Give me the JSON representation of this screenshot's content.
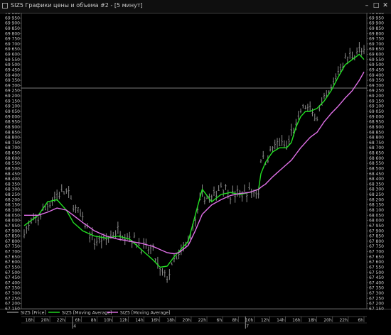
{
  "window": {
    "title": "SIZ5 Графики цены и объема #2 - [5 минут]",
    "buttons": {
      "minimize": "–",
      "maximize": "□",
      "close": "✕"
    }
  },
  "colors": {
    "background": "#000000",
    "price": "#8a8a8a",
    "ma_fast": "#22e022",
    "ma_slow": "#e070e8",
    "axis_text": "#c8c8c8",
    "gridline": "#3a3a3a"
  },
  "chart_data": {
    "type": "line",
    "title": "",
    "ylim": [
      67150,
      70000
    ],
    "y_tick_step": 50,
    "horizontal_level": 69275,
    "x_tick_labels": [
      "18h",
      "20h",
      "22h",
      "6h",
      "8h",
      "10h",
      "12h",
      "14h",
      "16h",
      "18h",
      "20h",
      "22h",
      "6h",
      "8h",
      "10h",
      "12h",
      "14h",
      "16h",
      "18h",
      "20h",
      "22h",
      "6h"
    ],
    "day_markers": [
      {
        "label": "4",
        "after_tick": 2
      },
      {
        "label": "7",
        "after_tick": 13
      }
    ],
    "legend_placement": "bottom",
    "series": [
      {
        "name": "SIZ5 [Price]",
        "style": "bars",
        "color": "#8a8a8a",
        "anchors": [
          [
            0,
            67900
          ],
          [
            6,
            68020
          ],
          [
            10,
            68150
          ],
          [
            14,
            68250
          ],
          [
            18,
            68280
          ],
          [
            21,
            68150
          ],
          [
            25,
            68000
          ],
          [
            30,
            67800
          ],
          [
            35,
            67820
          ],
          [
            40,
            67900
          ],
          [
            45,
            67850
          ],
          [
            50,
            67750
          ],
          [
            55,
            67700
          ],
          [
            58,
            67500
          ],
          [
            61,
            67450
          ],
          [
            64,
            67600
          ],
          [
            66,
            67650
          ],
          [
            70,
            67800
          ],
          [
            73,
            68000
          ],
          [
            76,
            68250
          ],
          [
            80,
            68200
          ],
          [
            84,
            68350
          ],
          [
            88,
            68250
          ],
          [
            92,
            68250
          ],
          [
            96,
            68280
          ],
          [
            100,
            68270
          ],
          [
            101,
            68600
          ],
          [
            103,
            68580
          ],
          [
            106,
            68700
          ],
          [
            109,
            68750
          ],
          [
            112,
            68700
          ],
          [
            114,
            68850
          ],
          [
            116,
            68900
          ],
          [
            118,
            69050
          ],
          [
            120,
            69100
          ],
          [
            122,
            69050
          ],
          [
            125,
            69000
          ],
          [
            128,
            69150
          ],
          [
            131,
            69250
          ],
          [
            134,
            69450
          ],
          [
            137,
            69550
          ],
          [
            140,
            69600
          ],
          [
            143,
            69650
          ],
          [
            145,
            69600
          ]
        ],
        "noise": 90
      },
      {
        "name": "SIZ5 [Moving Average]",
        "style": "line",
        "color": "#22e022",
        "anchors": [
          [
            0,
            67950
          ],
          [
            6,
            68050
          ],
          [
            10,
            68180
          ],
          [
            14,
            68200
          ],
          [
            18,
            68100
          ],
          [
            21,
            67980
          ],
          [
            25,
            67900
          ],
          [
            30,
            67850
          ],
          [
            35,
            67830
          ],
          [
            40,
            67850
          ],
          [
            45,
            67820
          ],
          [
            50,
            67720
          ],
          [
            55,
            67620
          ],
          [
            58,
            67550
          ],
          [
            61,
            67560
          ],
          [
            64,
            67650
          ],
          [
            66,
            67700
          ],
          [
            70,
            67800
          ],
          [
            73,
            68050
          ],
          [
            76,
            68300
          ],
          [
            80,
            68180
          ],
          [
            84,
            68250
          ],
          [
            88,
            68270
          ],
          [
            92,
            68250
          ],
          [
            96,
            68270
          ],
          [
            100,
            68300
          ],
          [
            101,
            68450
          ],
          [
            103,
            68560
          ],
          [
            106,
            68660
          ],
          [
            109,
            68700
          ],
          [
            112,
            68700
          ],
          [
            114,
            68750
          ],
          [
            116,
            68900
          ],
          [
            118,
            69000
          ],
          [
            120,
            69050
          ],
          [
            122,
            69050
          ],
          [
            125,
            69080
          ],
          [
            128,
            69150
          ],
          [
            131,
            69250
          ],
          [
            134,
            69380
          ],
          [
            137,
            69500
          ],
          [
            140,
            69550
          ],
          [
            143,
            69600
          ],
          [
            145,
            69550
          ]
        ]
      },
      {
        "name": "SIZ5 [Moving Average]",
        "style": "line",
        "color": "#e070e8",
        "anchors": [
          [
            0,
            68050
          ],
          [
            6,
            68050
          ],
          [
            10,
            68080
          ],
          [
            14,
            68120
          ],
          [
            18,
            68100
          ],
          [
            21,
            68050
          ],
          [
            25,
            67980
          ],
          [
            30,
            67900
          ],
          [
            35,
            67850
          ],
          [
            40,
            67820
          ],
          [
            45,
            67800
          ],
          [
            50,
            67780
          ],
          [
            55,
            67750
          ],
          [
            58,
            67720
          ],
          [
            61,
            67690
          ],
          [
            64,
            67680
          ],
          [
            66,
            67690
          ],
          [
            70,
            67760
          ],
          [
            73,
            67900
          ],
          [
            76,
            68060
          ],
          [
            80,
            68150
          ],
          [
            84,
            68200
          ],
          [
            88,
            68240
          ],
          [
            92,
            68260
          ],
          [
            96,
            68270
          ],
          [
            100,
            68300
          ],
          [
            101,
            68320
          ],
          [
            103,
            68350
          ],
          [
            106,
            68420
          ],
          [
            109,
            68480
          ],
          [
            112,
            68540
          ],
          [
            114,
            68580
          ],
          [
            116,
            68640
          ],
          [
            118,
            68700
          ],
          [
            120,
            68750
          ],
          [
            122,
            68800
          ],
          [
            125,
            68850
          ],
          [
            128,
            68950
          ],
          [
            131,
            69030
          ],
          [
            134,
            69100
          ],
          [
            137,
            69180
          ],
          [
            140,
            69250
          ],
          [
            143,
            69350
          ],
          [
            145,
            69430
          ]
        ]
      }
    ],
    "legend": [
      {
        "label": "SIZ5 [Price]",
        "color": "#8a8a8a"
      },
      {
        "label": "SIZ5 [Moving Average]",
        "color": "#22e022"
      },
      {
        "label": "SIZ5 [Moving Average]",
        "color": "#e070e8"
      }
    ]
  }
}
